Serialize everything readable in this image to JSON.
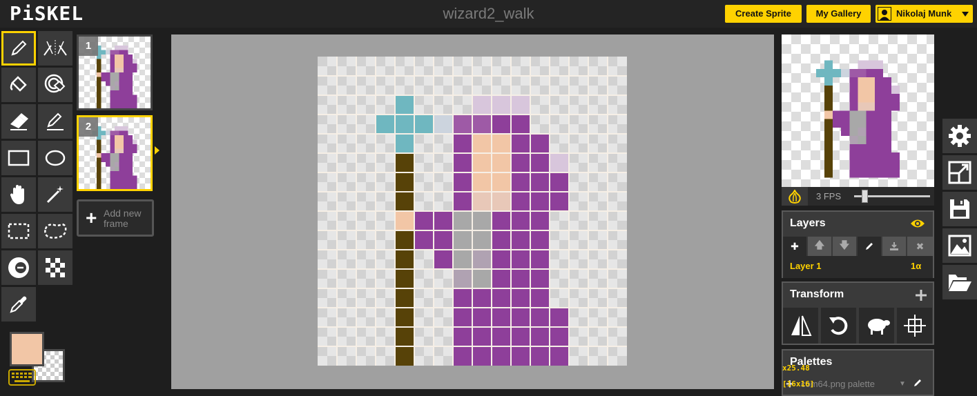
{
  "header": {
    "logo": "PiSKEL",
    "title": "wizard2_walk",
    "create_sprite": "Create Sprite",
    "my_gallery": "My Gallery",
    "user_name": "Nikolaj Munk"
  },
  "tools": [
    {
      "name": "pen-tool",
      "icon": "pencil-icon",
      "selected": true
    },
    {
      "name": "vertical-mirror-pen-tool",
      "icon": "mirror-pen-icon"
    },
    {
      "name": "paint-bucket-tool",
      "icon": "bucket-icon"
    },
    {
      "name": "paint-all-same-color-tool",
      "icon": "target-bucket-icon"
    },
    {
      "name": "eraser-tool",
      "icon": "eraser-icon"
    },
    {
      "name": "stroke-tool",
      "icon": "stroke-icon"
    },
    {
      "name": "rectangle-tool",
      "icon": "rectangle-icon"
    },
    {
      "name": "circle-tool",
      "icon": "circle-icon"
    },
    {
      "name": "move-tool",
      "icon": "hand-icon"
    },
    {
      "name": "shape-selection-tool",
      "icon": "magic-wand-icon"
    },
    {
      "name": "rectangle-selection-tool",
      "icon": "dashed-rectangle-icon"
    },
    {
      "name": "lasso-selection-tool",
      "icon": "lasso-icon"
    },
    {
      "name": "lighten-tool",
      "icon": "lighten-icon"
    },
    {
      "name": "dithering-tool",
      "icon": "checker-icon"
    },
    {
      "name": "color-picker-tool",
      "icon": "eyedropper-icon"
    }
  ],
  "colors": {
    "primary": "#f2c6a6",
    "secondary": "transparent",
    "accent": "#ffd200"
  },
  "frames": [
    {
      "number": "1",
      "selected": false
    },
    {
      "number": "2",
      "selected": true
    }
  ],
  "add_frame_label": "Add new frame",
  "animation": {
    "fps_label": "3 FPS",
    "fps": 3
  },
  "layers": {
    "title": "Layers",
    "items": [
      {
        "name": "Layer 1",
        "opacity": "1α"
      }
    ]
  },
  "transform": {
    "title": "Transform"
  },
  "palettes": {
    "title": "Palettes",
    "selected": "com64.png palette"
  },
  "readouts": {
    "zoom": "x25.48",
    "size": "[16x16]"
  },
  "sprite": {
    "size": 16,
    "palette": {
      "T": "#6fb7c0",
      "t": "#ccd4de",
      "P": "#8e3f9a",
      "p": "#9e5aa6",
      "q": "#d8c6dc",
      "S": "#f2c6a6",
      "s": "#e8c8b8",
      "G": "#a8a8a8",
      "g": "#b0a2b2",
      "B": "#574208"
    },
    "rows": [
      "................",
      "................",
      "....T...qqq.....",
      "...TTTtppPP.....",
      "....T..PSSPP....",
      "....B..PSSPPq...",
      "....B..PSSPPP...",
      "....B..PssPPP...",
      "....SPPGGPPP....",
      "....BPPGGPPP....",
      "....B.PGgPPP....",
      "....B..gGPPP....",
      "....B..PPPPP....",
      "....B..PPPPPP...",
      "....B..PPPPPP...",
      "....B..PPPPPP..."
    ]
  }
}
